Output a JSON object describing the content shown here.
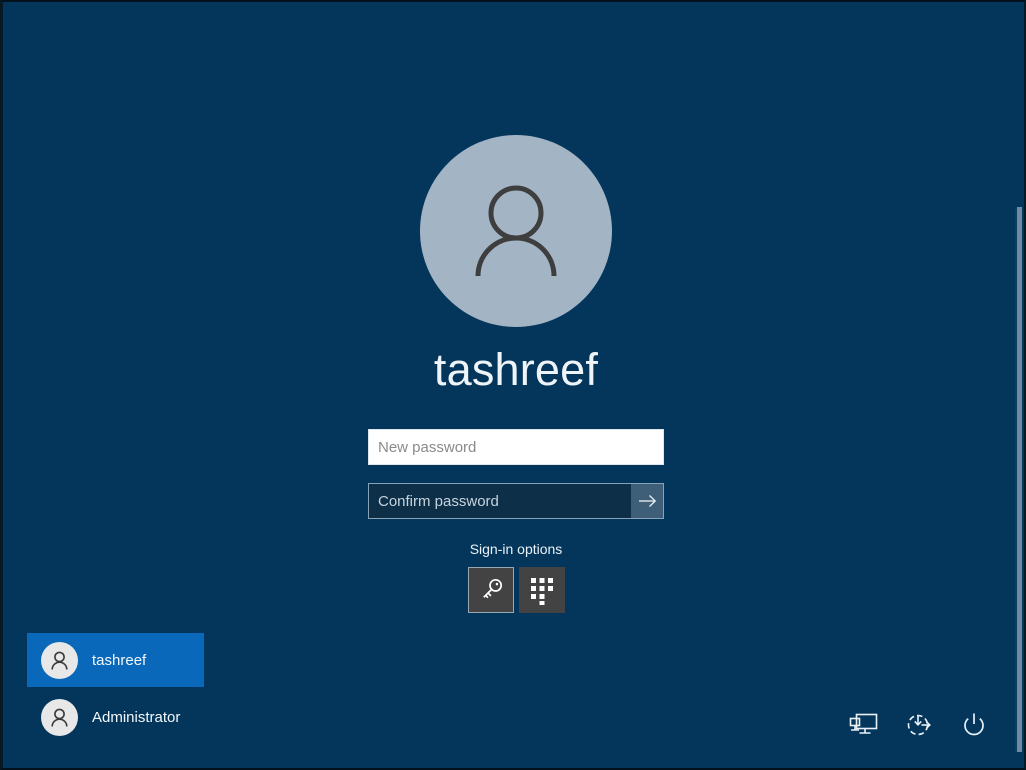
{
  "screen": {
    "name": "windows-lock-screen",
    "background_color": "#04365c",
    "accent_color": "#0a68bb"
  },
  "account": {
    "display_name": "tashreef",
    "avatar_icon": "person-avatar-icon",
    "avatar_bg_color": "#a3b4c4"
  },
  "password_form": {
    "new_password": {
      "placeholder": "New password",
      "value": "",
      "state": "focused"
    },
    "confirm_password": {
      "placeholder": "Confirm password",
      "value": "",
      "state": "idle"
    },
    "submit": {
      "icon": "arrow-right-icon",
      "label": "Submit"
    }
  },
  "signin_options": {
    "label": "Sign-in options",
    "options": [
      {
        "name": "password-key-option",
        "icon": "key-icon",
        "selected": true
      },
      {
        "name": "pin-keypad-option",
        "icon": "keypad-icon",
        "selected": false
      }
    ]
  },
  "user_list": {
    "users": [
      {
        "name": "tashreef",
        "avatar_icon": "person-avatar-icon",
        "selected": true
      },
      {
        "name": "Administrator",
        "avatar_icon": "person-avatar-icon",
        "selected": false
      }
    ]
  },
  "system_actions": [
    {
      "name": "network-icon",
      "label": "Network"
    },
    {
      "name": "ease-of-access-icon",
      "label": "Ease of Access"
    },
    {
      "name": "power-icon",
      "label": "Power"
    }
  ]
}
